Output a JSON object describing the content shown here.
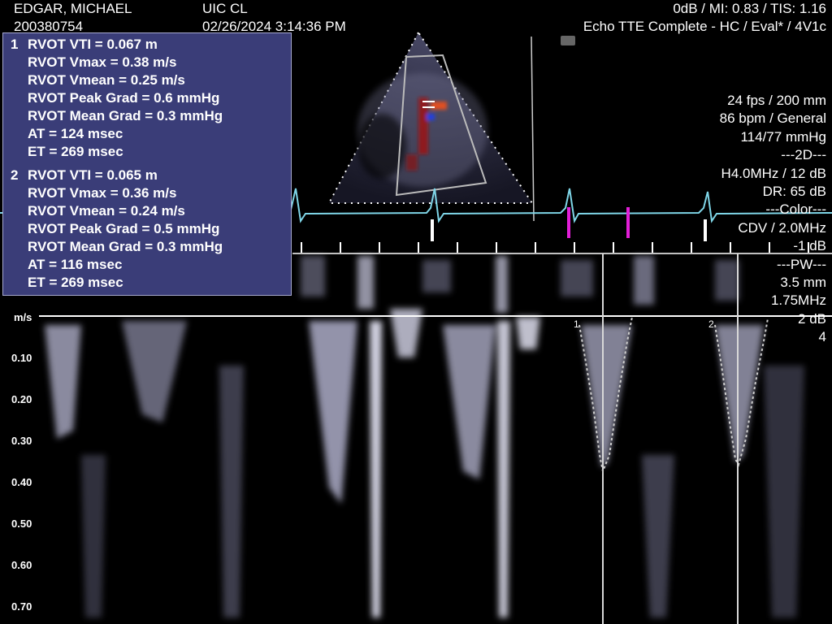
{
  "header": {
    "patient_name": "EDGAR, MICHAEL",
    "patient_id": "200380754",
    "institution": "UIC CL",
    "datetime": "02/26/2024 3:14:36 PM",
    "output_line": "0dB / MI: 0.83 / TIS: 1.16",
    "exam_line": "Echo TTE Complete - HC  / Eval* / 4V1c"
  },
  "params": [
    "24 fps / 200 mm",
    "86 bpm / General",
    "114/77 mmHg",
    "---2D---",
    "H4.0MHz / 12 dB",
    "DR: 65 dB",
    "---Color---",
    "CDV / 2.0MHz",
    "-1 dB",
    "---PW---",
    "3.5 mm",
    "1.75MHz",
    "2 dB",
    "4"
  ],
  "measurements": [
    {
      "index": "1",
      "lines": [
        "RVOT VTI = 0.067 m",
        "RVOT Vmax = 0.38 m/s",
        "RVOT Vmean = 0.25 m/s",
        "RVOT Peak Grad = 0.6 mmHg",
        "RVOT Mean Grad = 0.3 mmHg",
        "AT = 124 msec",
        "ET = 269 msec"
      ]
    },
    {
      "index": "2",
      "lines": [
        "RVOT VTI = 0.065 m",
        "RVOT Vmax = 0.36 m/s",
        "RVOT Vmean = 0.24 m/s",
        "RVOT Peak Grad = 0.5 mmHg",
        "RVOT Mean Grad = 0.3 mmHg",
        "AT = 116 msec",
        "ET = 269 msec"
      ]
    }
  ],
  "doppler_axis": {
    "unit": "m/s",
    "ticks": [
      "0.10",
      "0.20",
      "0.30",
      "0.40",
      "0.50",
      "0.60",
      "0.70"
    ]
  },
  "trace_markers": [
    "1",
    "2"
  ],
  "colors": {
    "ecg": "#7fd6e8",
    "marker": "#e21fd8",
    "panel": "#3a3d78",
    "spectral": "#c9c9e0"
  }
}
